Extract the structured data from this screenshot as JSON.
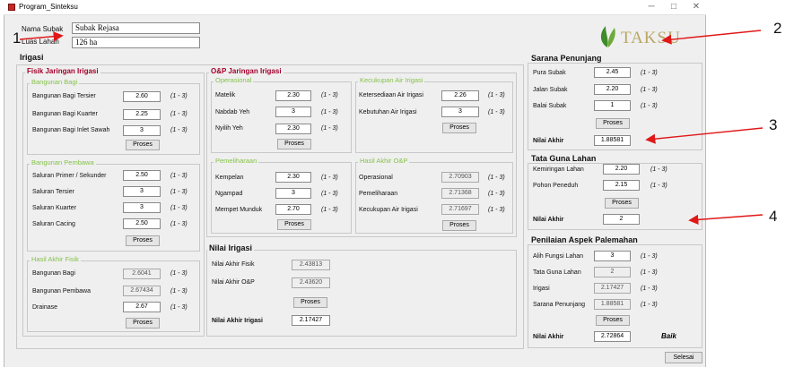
{
  "window": {
    "title": "Program_Sinteksu",
    "min": "─",
    "max": "□",
    "close": "✕"
  },
  "annotations": {
    "n1": "1",
    "n2": "2",
    "n3": "3",
    "n4": "4"
  },
  "logo": {
    "text": "TAKSU"
  },
  "header": {
    "nama_label": "Nama Subak",
    "nama_value": "Subak Rejasa",
    "luas_label": "Luas Lahan",
    "luas_value": "126 ha"
  },
  "irigasi": {
    "title": "Irigasi",
    "fisik": {
      "title": "Fisik Jaringan Irigasi",
      "bagi": {
        "title": "Bangunan Bagi",
        "rows": [
          {
            "label": "Bangunan Bagi Tersier",
            "value": "2.60",
            "range": "(1 - 3)"
          },
          {
            "label": "Bangunan Bagi Kuarter",
            "value": "2.25",
            "range": "(1 - 3)"
          },
          {
            "label": "Bangunan Bagi Inlet Sawah",
            "value": "3",
            "range": "(1 - 3)"
          }
        ],
        "button": "Proses"
      },
      "pembawa": {
        "title": "Bangunan Pembawa",
        "rows": [
          {
            "label": "Saluran Primer / Sekunder",
            "value": "2.50",
            "range": "(1 - 3)"
          },
          {
            "label": "Saluran Tersier",
            "value": "3",
            "range": "(1 - 3)"
          },
          {
            "label": "Saluran Kuarter",
            "value": "3",
            "range": "(1 - 3)"
          },
          {
            "label": "Saluran Cacing",
            "value": "2.50",
            "range": "(1 - 3)"
          }
        ],
        "button": "Proses"
      },
      "hasil": {
        "title": "Hasil Akhir Fisik",
        "rows": [
          {
            "label": "Bangunan Bagi",
            "value": "2.6041",
            "range": "(1 - 3)"
          },
          {
            "label": "Bangunan Pembawa",
            "value": "2.67434",
            "range": "(1 - 3)"
          },
          {
            "label": "Drainase",
            "value": "2.67",
            "range": "(1 - 3)"
          }
        ],
        "button": "Proses"
      }
    },
    "op": {
      "title": "O&P Jaringan Irigasi",
      "operasional": {
        "title": "Operasional",
        "rows": [
          {
            "label": "Matelik",
            "value": "2.30",
            "range": "(1 - 3)"
          },
          {
            "label": "Nabdab Yeh",
            "value": "3",
            "range": "(1 - 3)"
          },
          {
            "label": "Nyilih Yeh",
            "value": "2.30",
            "range": "(1 - 3)"
          }
        ],
        "button": "Proses"
      },
      "kecukupan": {
        "title": "Kecukupan Air Irigasi",
        "rows": [
          {
            "label": "Ketersediaan Air Irigasi",
            "value": "2.26",
            "range": "(1 - 3)"
          },
          {
            "label": "Kebutuhan Air Irigasi",
            "value": "3",
            "range": "(1 - 3)"
          }
        ],
        "button": "Proses"
      },
      "pemeliharaan": {
        "title": "Pemeliharaan",
        "rows": [
          {
            "label": "Kempelan",
            "value": "2.30",
            "range": "(1 - 3)"
          },
          {
            "label": "Ngampad",
            "value": "3",
            "range": "(1 - 3)"
          },
          {
            "label": "Mempet Munduk",
            "value": "2.70",
            "range": "(1 - 3)"
          }
        ],
        "button": "Proses"
      },
      "hasil": {
        "title": "Hasil Akhir O&P",
        "rows": [
          {
            "label": "Operasional",
            "value": "2.70903",
            "range": "(1 - 3)"
          },
          {
            "label": "Pemeliharaan",
            "value": "2.71368",
            "range": "(1 - 3)"
          },
          {
            "label": "Kecukupan Air Irigasi",
            "value": "2.71697",
            "range": "(1 - 3)"
          }
        ],
        "button": "Proses"
      }
    }
  },
  "nilai_irigasi": {
    "title": "Nilai Irigasi",
    "fisik_label": "Nilai Akhir Fisik",
    "fisik_value": "2.43813",
    "op_label": "Nilai Akhir O&P",
    "op_value": "2.43620",
    "button": "Proses",
    "akhir_label": "Nilai Akhir Irigasi",
    "akhir_value": "2.17427"
  },
  "sarana": {
    "title": "Sarana Penunjang",
    "rows": [
      {
        "label": "Pura Subak",
        "value": "2.45",
        "range": "(1 - 3)"
      },
      {
        "label": "Jalan Subak",
        "value": "2.20",
        "range": "(1 - 3)"
      },
      {
        "label": "Balai Subak",
        "value": "1",
        "range": "(1 - 3)"
      }
    ],
    "button": "Proses",
    "akhir_label": "Nilai Akhir",
    "akhir_value": "1.88581"
  },
  "tataguna": {
    "title": "Tata Guna Lahan",
    "rows": [
      {
        "label": "Kemiringan Lahan",
        "value": "2.20",
        "range": "(1 - 3)"
      },
      {
        "label": "Pohon Peneduh",
        "value": "2.15",
        "range": "(1 - 3)"
      }
    ],
    "button": "Proses",
    "akhir_label": "Nilai Akhir",
    "akhir_value": "2"
  },
  "palemahan": {
    "title": "Penilaian Aspek Palemahan",
    "rows": [
      {
        "label": "Alih Fungsi Lahan",
        "value": "3",
        "range": "(1 - 3)"
      },
      {
        "label": "Tata Guna Lahan",
        "value": "2",
        "range": "(1 - 3)"
      },
      {
        "label": "Irigasi",
        "value": "2.17427",
        "range": "(1 - 3)"
      },
      {
        "label": "Sarana Penunjang",
        "value": "1.88581",
        "range": "(1 - 3)"
      }
    ],
    "button": "Proses",
    "akhir_label": "Nilai Akhir",
    "akhir_value": "2.72864",
    "status": "Baik"
  },
  "selesai": "Selesai",
  "colors": {
    "annotation": "#e01818",
    "green_title": "#86c24b",
    "maroon_title": "#a3002c",
    "logo_green": "#3f8a2a"
  }
}
